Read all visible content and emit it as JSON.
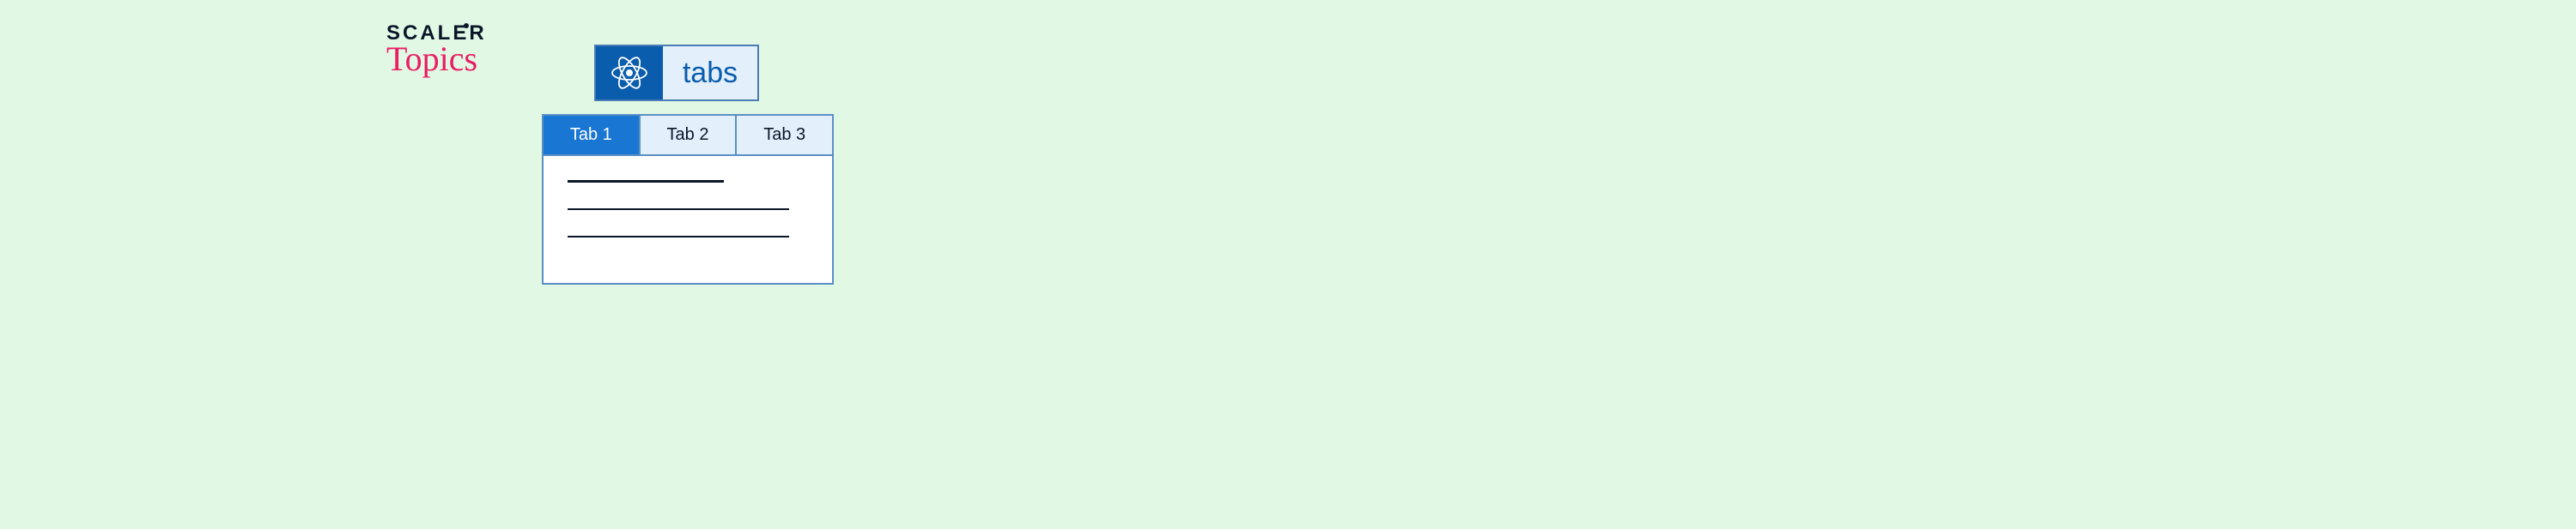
{
  "brand": {
    "line1": "SCALER",
    "line2": "Topics"
  },
  "header": {
    "title": "tabs",
    "icon": "react-icon"
  },
  "widget": {
    "tabs": [
      {
        "label": "Tab 1",
        "active": true
      },
      {
        "label": "Tab 2",
        "active": false
      },
      {
        "label": "Tab 3",
        "active": false
      }
    ]
  },
  "colors": {
    "page_bg": "#e1f8e4",
    "react_box": "#0a5cad",
    "tab_active": "#1976d2",
    "tab_inactive_bg": "#e3f0fb",
    "border": "#5a8fc6",
    "brand_accent": "#e91e63"
  }
}
